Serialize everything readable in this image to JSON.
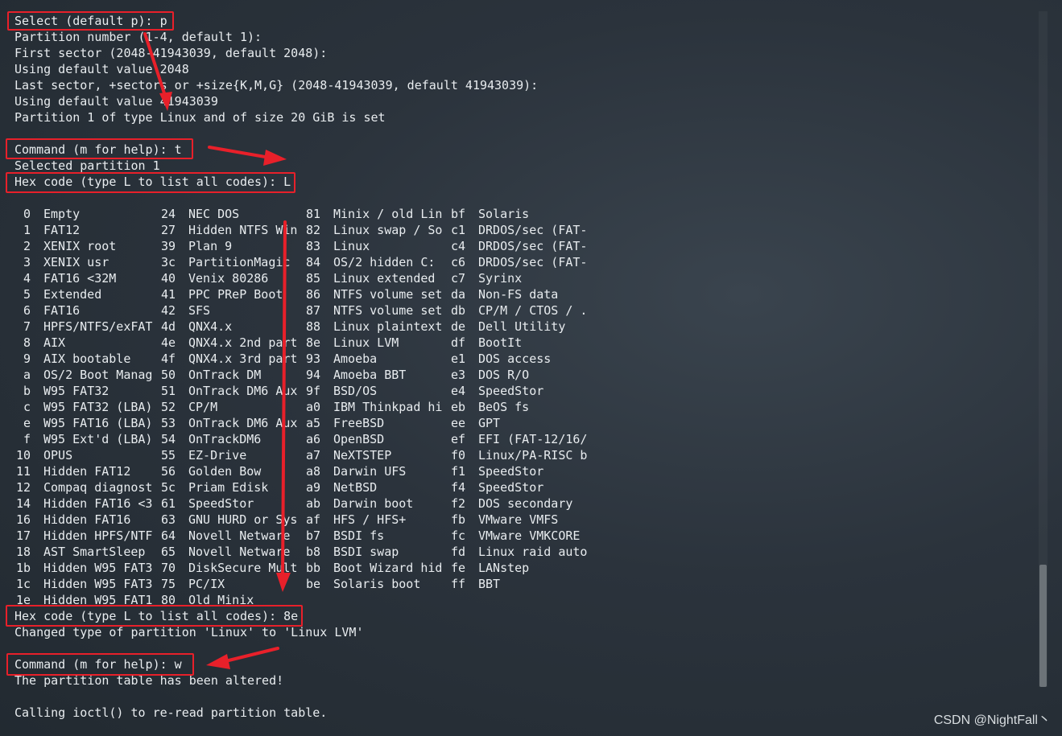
{
  "terminal": {
    "lines_top": [
      "Select (default p): p",
      "Partition number (1-4, default 1):",
      "First sector (2048-41943039, default 2048):",
      "Using default value 2048",
      "Last sector, +sectors or +size{K,M,G} (2048-41943039, default 41943039):",
      "Using default value 41943039",
      "Partition 1 of type Linux and of size 20 GiB is set",
      "",
      "Command (m for help): t",
      "Selected partition 1",
      "Hex code (type L to list all codes): L"
    ],
    "codes": [
      [
        "0",
        "Empty",
        "24",
        "NEC DOS",
        "81",
        "Minix / old Lin",
        "bf",
        "Solaris"
      ],
      [
        "1",
        "FAT12",
        "27",
        "Hidden NTFS Win",
        "82",
        "Linux swap / So",
        "c1",
        "DRDOS/sec (FAT-"
      ],
      [
        "2",
        "XENIX root",
        "39",
        "Plan 9",
        "83",
        "Linux",
        "c4",
        "DRDOS/sec (FAT-"
      ],
      [
        "3",
        "XENIX usr",
        "3c",
        "PartitionMagic",
        "84",
        "OS/2 hidden C:",
        "c6",
        "DRDOS/sec (FAT-"
      ],
      [
        "4",
        "FAT16 <32M",
        "40",
        "Venix 80286",
        "85",
        "Linux extended",
        "c7",
        "Syrinx"
      ],
      [
        "5",
        "Extended",
        "41",
        "PPC PReP Boot",
        "86",
        "NTFS volume set",
        "da",
        "Non-FS data"
      ],
      [
        "6",
        "FAT16",
        "42",
        "SFS",
        "87",
        "NTFS volume set",
        "db",
        "CP/M / CTOS / ."
      ],
      [
        "7",
        "HPFS/NTFS/exFAT",
        "4d",
        "QNX4.x",
        "88",
        "Linux plaintext",
        "de",
        "Dell Utility"
      ],
      [
        "8",
        "AIX",
        "4e",
        "QNX4.x 2nd part",
        "8e",
        "Linux LVM",
        "df",
        "BootIt"
      ],
      [
        "9",
        "AIX bootable",
        "4f",
        "QNX4.x 3rd part",
        "93",
        "Amoeba",
        "e1",
        "DOS access"
      ],
      [
        "a",
        "OS/2 Boot Manag",
        "50",
        "OnTrack DM",
        "94",
        "Amoeba BBT",
        "e3",
        "DOS R/O"
      ],
      [
        "b",
        "W95 FAT32",
        "51",
        "OnTrack DM6 Aux",
        "9f",
        "BSD/OS",
        "e4",
        "SpeedStor"
      ],
      [
        "c",
        "W95 FAT32 (LBA)",
        "52",
        "CP/M",
        "a0",
        "IBM Thinkpad hi",
        "eb",
        "BeOS fs"
      ],
      [
        "e",
        "W95 FAT16 (LBA)",
        "53",
        "OnTrack DM6 Aux",
        "a5",
        "FreeBSD",
        "ee",
        "GPT"
      ],
      [
        "f",
        "W95 Ext'd (LBA)",
        "54",
        "OnTrackDM6",
        "a6",
        "OpenBSD",
        "ef",
        "EFI (FAT-12/16/"
      ],
      [
        "10",
        "OPUS",
        "55",
        "EZ-Drive",
        "a7",
        "NeXTSTEP",
        "f0",
        "Linux/PA-RISC b"
      ],
      [
        "11",
        "Hidden FAT12",
        "56",
        "Golden Bow",
        "a8",
        "Darwin UFS",
        "f1",
        "SpeedStor"
      ],
      [
        "12",
        "Compaq diagnost",
        "5c",
        "Priam Edisk",
        "a9",
        "NetBSD",
        "f4",
        "SpeedStor"
      ],
      [
        "14",
        "Hidden FAT16 <3",
        "61",
        "SpeedStor",
        "ab",
        "Darwin boot",
        "f2",
        "DOS secondary"
      ],
      [
        "16",
        "Hidden FAT16",
        "63",
        "GNU HURD or Sys",
        "af",
        "HFS / HFS+",
        "fb",
        "VMware VMFS"
      ],
      [
        "17",
        "Hidden HPFS/NTF",
        "64",
        "Novell Netware",
        "b7",
        "BSDI fs",
        "fc",
        "VMware VMKCORE"
      ],
      [
        "18",
        "AST SmartSleep",
        "65",
        "Novell Netware",
        "b8",
        "BSDI swap",
        "fd",
        "Linux raid auto"
      ],
      [
        "1b",
        "Hidden W95 FAT3",
        "70",
        "DiskSecure Mult",
        "bb",
        "Boot Wizard hid",
        "fe",
        "LANstep"
      ],
      [
        "1c",
        "Hidden W95 FAT3",
        "75",
        "PC/IX",
        "be",
        "Solaris boot",
        "ff",
        "BBT"
      ],
      [
        "1e",
        "Hidden W95 FAT1",
        "80",
        "Old Minix",
        "",
        "",
        "",
        ""
      ]
    ],
    "lines_bottom": [
      "Hex code (type L to list all codes): 8e",
      "Changed type of partition 'Linux' to 'Linux LVM'",
      "",
      "Command (m for help): w",
      "The partition table has been altered!",
      "",
      "Calling ioctl() to re-read partition table."
    ]
  },
  "colors": {
    "background": "#2b333c",
    "text": "#e8ecef",
    "highlight": "#e8202a"
  },
  "watermark": "CSDN @NightFall丶"
}
